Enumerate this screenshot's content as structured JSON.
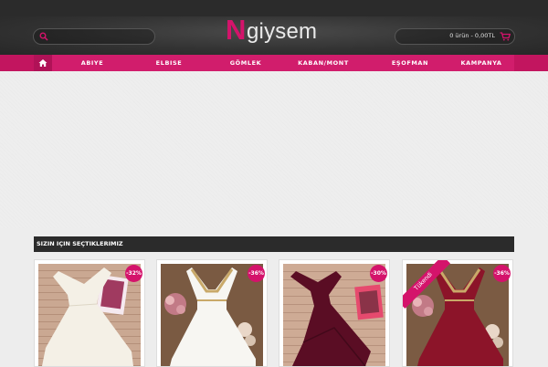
{
  "header": {
    "search": {
      "placeholder": ""
    },
    "logo": {
      "initial": "N",
      "rest": "giysem"
    },
    "cart": {
      "summary": "0 ürün - 0,00TL",
      "icon": "cart-icon"
    }
  },
  "nav": {
    "home_icon": "home-icon",
    "items": [
      {
        "label": "ABIYE"
      },
      {
        "label": "ELBISE"
      },
      {
        "label": "GÖMLEK"
      },
      {
        "label": "KABAN/MONT"
      },
      {
        "label": "EŞOFMAN"
      },
      {
        "label": "KAMPANYA"
      }
    ]
  },
  "section": {
    "title": "SIZIN IÇIN SEÇTIKLERIMIZ"
  },
  "products": [
    {
      "discount": "-32%",
      "color": "#f4f0e6",
      "ribbon": ""
    },
    {
      "discount": "-36%",
      "color": "#f7f6f2",
      "ribbon": ""
    },
    {
      "discount": "-30%",
      "color": "#5a0d24",
      "ribbon": ""
    },
    {
      "discount": "-36%",
      "color": "#8c1429",
      "ribbon": "Tükendi"
    }
  ],
  "colors": {
    "accent": "#d4136b",
    "nav": "#d11d6c",
    "dark": "#2b2b2b"
  }
}
